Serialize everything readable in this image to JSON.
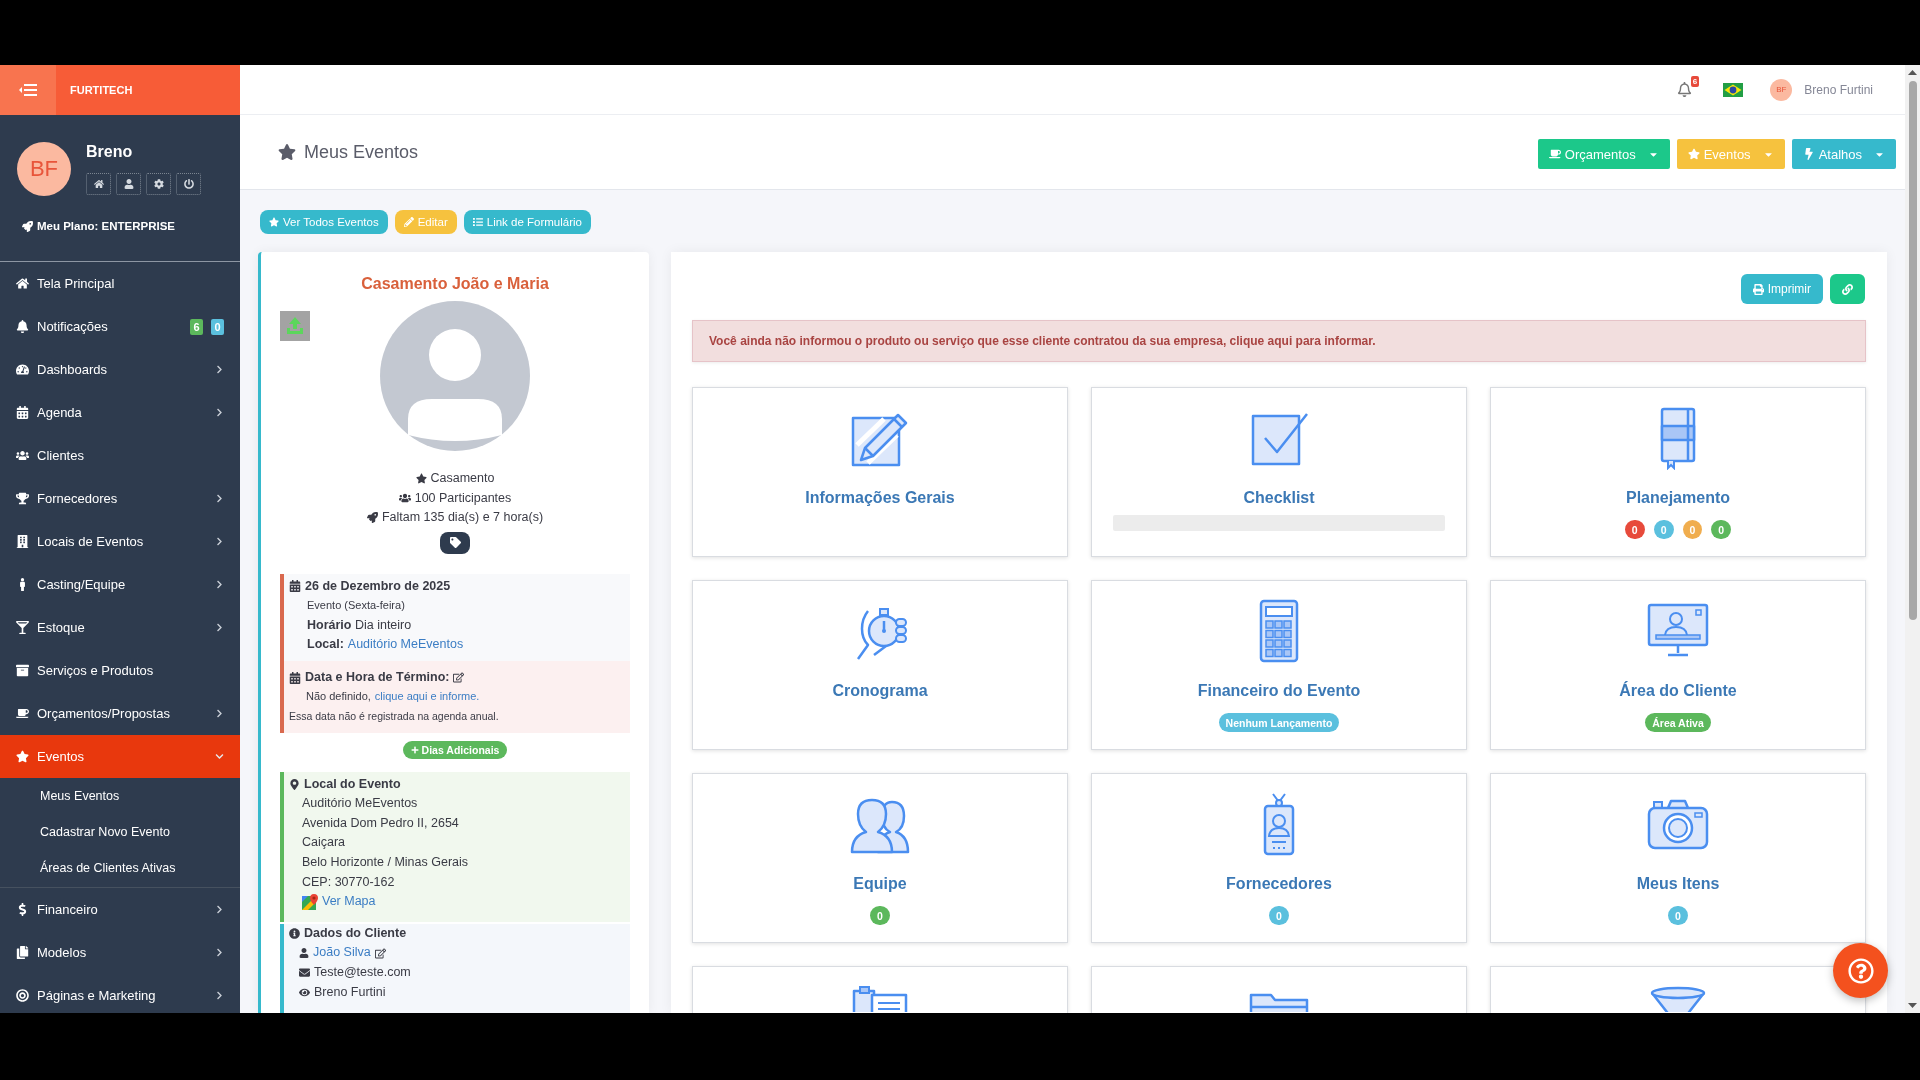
{
  "sidebar": {
    "brand": "FURTITECH",
    "user": {
      "initials": "BF",
      "name": "Breno"
    },
    "plan": "Meu Plano: ENTERPRISE",
    "items": [
      {
        "label": "Tela Principal",
        "selected": false
      },
      {
        "label": "Notificações",
        "selected": false,
        "badges": [
          {
            "text": "6",
            "color": "#5cb85c"
          },
          {
            "text": "0",
            "color": "#5bc0de"
          }
        ]
      },
      {
        "label": "Dashboards",
        "selected": false,
        "expanded": false
      },
      {
        "label": "Agenda",
        "selected": false,
        "expanded": false
      },
      {
        "label": "Clientes",
        "selected": false
      },
      {
        "label": "Fornecedores",
        "selected": false,
        "expanded": false
      },
      {
        "label": "Locais de Eventos",
        "selected": false,
        "expanded": false
      },
      {
        "label": "Casting/Equipe",
        "selected": false,
        "expanded": false
      },
      {
        "label": "Estoque",
        "selected": false,
        "expanded": false
      },
      {
        "label": "Serviços e Produtos",
        "selected": false
      },
      {
        "label": "Orçamentos/Propostas",
        "selected": false,
        "expanded": false
      },
      {
        "label": "Eventos",
        "selected": true,
        "expanded": true,
        "children": [
          {
            "label": "Meus Eventos",
            "selected": false
          },
          {
            "label": "Cadastrar Novo Evento",
            "selected": false
          },
          {
            "label": "Áreas de Clientes Ativas",
            "selected": false
          }
        ]
      },
      {
        "label": "Financeiro",
        "selected": false,
        "expanded": false
      },
      {
        "label": "Modelos",
        "selected": false,
        "expanded": false
      },
      {
        "label": "Páginas e Marketing",
        "selected": false,
        "expanded": false
      }
    ]
  },
  "topbar": {
    "notification_count": "6",
    "user": {
      "initials": "BF",
      "name": "Breno Furtini"
    }
  },
  "page_header": {
    "title": "Meus Eventos",
    "buttons": [
      {
        "label": "Orçamentos",
        "color": "#1cc88a"
      },
      {
        "label": "Eventos",
        "color": "#f6c23e"
      },
      {
        "label": "Atalhos",
        "color": "#36b9cc"
      }
    ]
  },
  "actions": [
    {
      "label": "Ver Todos Eventos",
      "color": "#36b9cc"
    },
    {
      "label": "Editar",
      "color": "#f6c23e"
    },
    {
      "label": "Link de Formulário",
      "color": "#36b9cc"
    }
  ],
  "event": {
    "title": "Casamento João e Maria",
    "type": "Casamento",
    "participants": "100 Participantes",
    "countdown": "Faltam 135 dia(s) e 7 hora(s)",
    "date": {
      "heading": "26 de Dezembro de 2025",
      "weekday": "Evento (Sexta-feira)",
      "time": "**Horário** Dia inteiro",
      "place_label": "Local:",
      "place": "Auditório MeEventos"
    },
    "end": {
      "heading": "Data e Hora de Término:",
      "status": "Não definido,",
      "link": "clique aqui e informe.",
      "note": "Essa data não é registrada na agenda anual."
    },
    "extra_days_button": "Dias Adicionais",
    "location": {
      "heading": "Local do Evento",
      "lines": [
        "Auditório MeEventos",
        "Avenida Dom Pedro II, 2654",
        "Caiçara",
        "Belo Horizonte / Minas Gerais",
        "CEP: 30770-162"
      ],
      "map_link": "Ver Mapa"
    },
    "client": {
      "heading": "Dados do Cliente",
      "name": "João Silva",
      "email": "Teste@teste.com",
      "owner": "Breno Furtini"
    }
  },
  "panel": {
    "print_button": "Imprimir",
    "alert": "Você ainda não informou o produto ou serviço que esse cliente contratou da sua empresa, clique aqui para informar.",
    "cards": [
      {
        "kind": "plain",
        "title": "Informações Gerais"
      },
      {
        "kind": "progress",
        "title": "Checklist"
      },
      {
        "kind": "badges",
        "title": "Planejamento",
        "badges": [
          {
            "text": "0",
            "color": "#e74a3b"
          },
          {
            "text": "0",
            "color": "#5bc0de"
          },
          {
            "text": "0",
            "color": "#f0ad4e"
          },
          {
            "text": "0",
            "color": "#5cb85c"
          }
        ]
      },
      {
        "kind": "plain",
        "title": "Cronograma"
      },
      {
        "kind": "badges",
        "title": "Financeiro do Evento",
        "badges": [
          {
            "text": "Nenhum Lançamento",
            "color": "#5bc0de"
          }
        ]
      },
      {
        "kind": "badges",
        "title": "Área do Cliente",
        "badges": [
          {
            "text": "Área Ativa",
            "color": "#5cb85c"
          }
        ]
      },
      {
        "kind": "badges",
        "title": "Equipe",
        "badges": [
          {
            "text": "0",
            "color": "#5cb85c"
          }
        ]
      },
      {
        "kind": "badges",
        "title": "Fornecedores",
        "badges": [
          {
            "text": "0",
            "color": "#5bc0de"
          }
        ]
      },
      {
        "kind": "badges",
        "title": "Meus Itens",
        "badges": [
          {
            "text": "0",
            "color": "#5bc0de"
          }
        ]
      },
      {
        "kind": "cut"
      },
      {
        "kind": "cut"
      },
      {
        "kind": "cut"
      }
    ]
  }
}
